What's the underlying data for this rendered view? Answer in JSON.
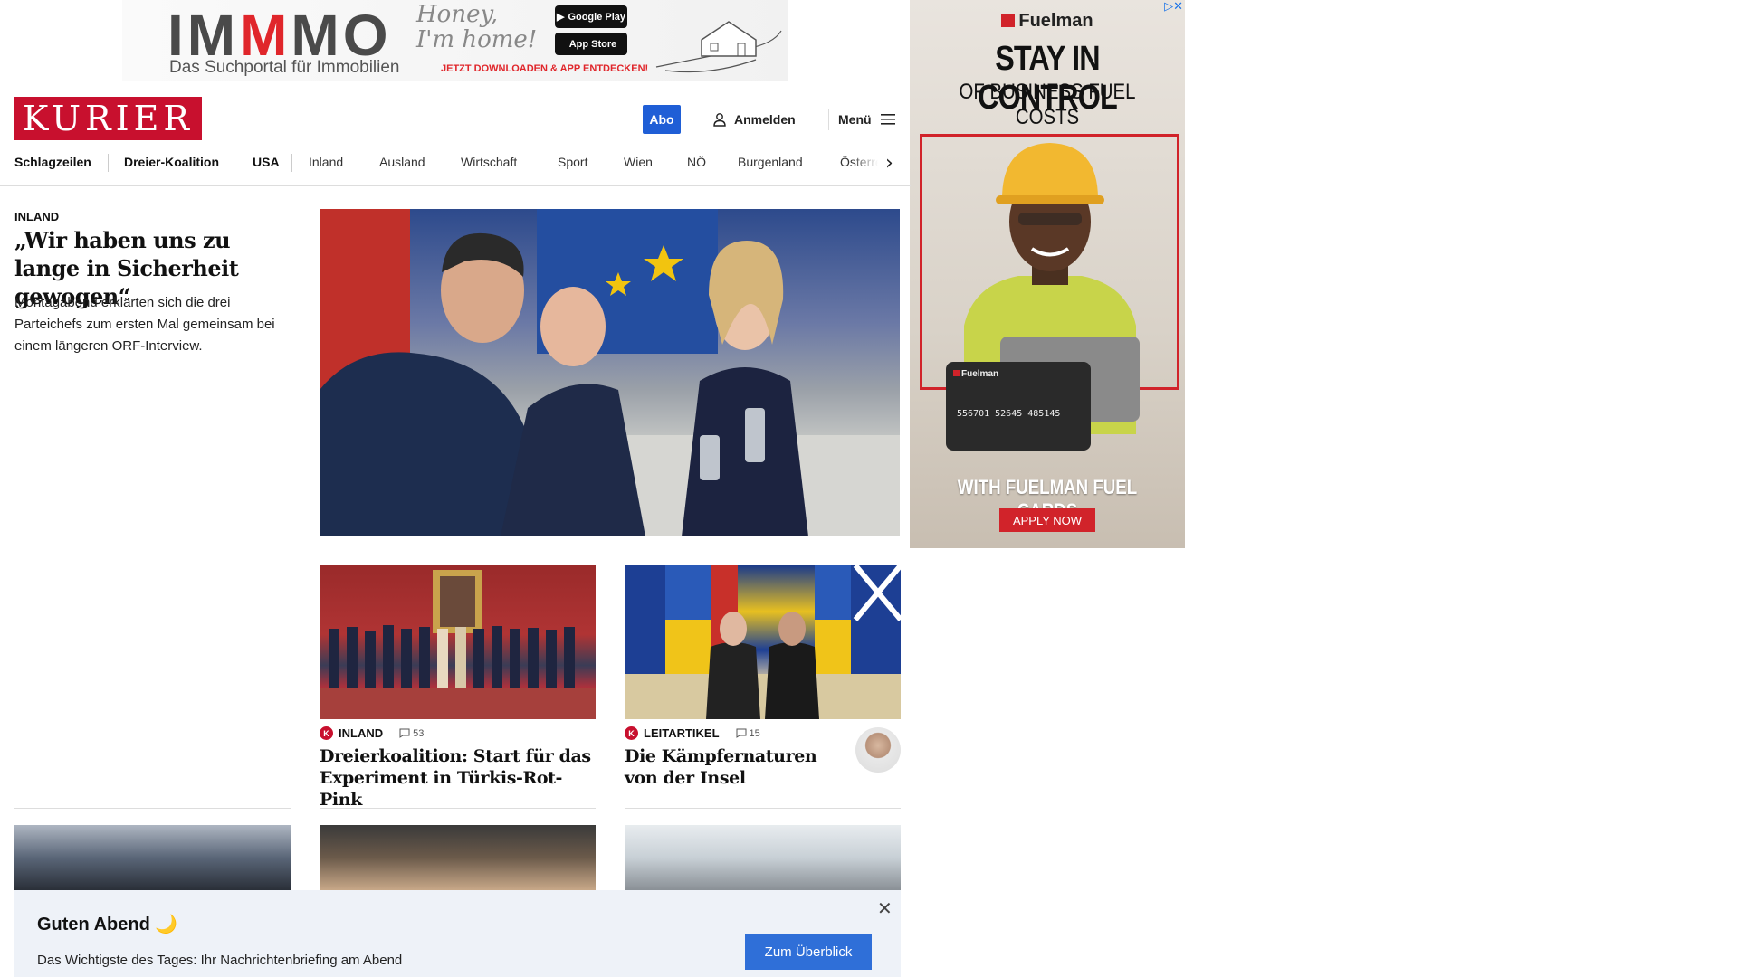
{
  "top_ad": {
    "brand_a": "IM",
    "brand_b": "M",
    "brand_c": "MO",
    "tagline": "Das Suchportal für Immobilien",
    "slogan": "Honey, I'm home!",
    "google_play": "Google Play",
    "app_store": "App Store",
    "cta": "JETZT DOWNLOADEN & APP ENTDECKEN!"
  },
  "header": {
    "logo": "KURIER",
    "abo_label": "Abo",
    "login_label": "Anmelden",
    "menu_label": "Menü"
  },
  "nav": {
    "items": [
      "Schlagzeilen",
      "Dreier-Koalition",
      "USA",
      "Inland",
      "Ausland",
      "Wirtschaft",
      "Sport",
      "Wien",
      "NÖ",
      "Burgenland",
      "Österre"
    ]
  },
  "lead": {
    "kicker": "INLAND",
    "title": "„Wir haben uns zu lange in Sicherheit gewogen“",
    "teaser": "Montagabend erklärten sich die drei Parteichefs zum ersten Mal gemeinsam bei einem längeren ORF-Interview."
  },
  "cards": [
    {
      "kicker": "INLAND",
      "comments": "53",
      "title": "Dreierkoalition: Start für das Experiment in Türkis-Rot-Pink"
    },
    {
      "kicker": "LEITARTIKEL",
      "comments": "15",
      "title": "Die Kämpfernaturen von der Insel"
    }
  ],
  "briefing": {
    "title": "Guten Abend 🌙",
    "text": "Das Wichtigste des Tages: Ihr Nachrichtenbriefing am Abend",
    "button": "Zum Überblick"
  },
  "side_ad": {
    "brand": "Fuelman",
    "headline": "STAY IN CONTROL",
    "subheadline": "OF BUSINESS FUEL COSTS",
    "card_brand": "Fuelman",
    "card_number": "556701 52645 485145",
    "footer": "WITH FUELMAN FUEL CARDS",
    "cta": "APPLY NOW"
  },
  "colors": {
    "brand_red": "#c8102e",
    "abo_blue": "#1f5ed6",
    "button_blue": "#2f6fd8",
    "briefing_bg": "#eef2f8"
  },
  "icons": [
    "user-icon",
    "hamburger-icon",
    "chevron-right-icon",
    "comment-icon",
    "close-icon",
    "k-badge-icon",
    "ad-choices-icon"
  ]
}
